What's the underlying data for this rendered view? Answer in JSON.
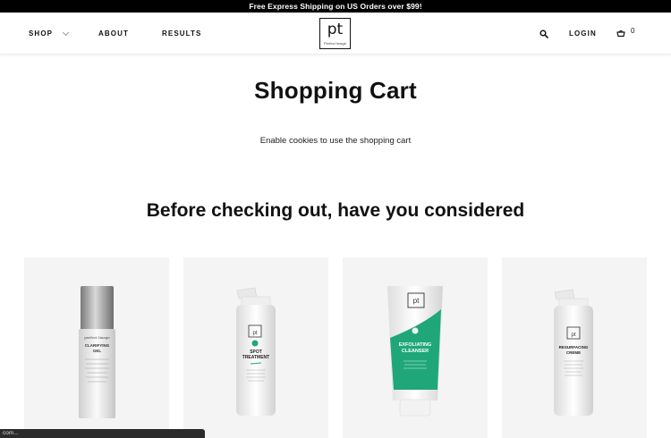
{
  "promo": {
    "text": "Free Express Shipping on US Orders over $99!"
  },
  "nav": {
    "shop": "SHOP",
    "about": "ABOUT",
    "results": "RESULTS",
    "login": "LOGIN",
    "cart_count": "0"
  },
  "logo": {
    "mark": "pt",
    "sub": "Perfect Image"
  },
  "main": {
    "title": "Shopping Cart",
    "cookie_message": "Enable cookies to use the shopping cart",
    "recommend_title": "Before checking out, have you considered"
  },
  "products": [
    {
      "brand": "perfect Image",
      "name_line1": "CLARIFYING",
      "name_line2": "GEL"
    },
    {
      "brand": "pt",
      "name_line1": "SPOT",
      "name_line2": "TREATMENT"
    },
    {
      "brand": "pt",
      "name_line1": "EXFOLIATING",
      "name_line2": "CLEANSER"
    },
    {
      "brand": "pt",
      "name_line1": "RESURFACING",
      "name_line2": "CREME"
    }
  ],
  "status_bar": {
    "text": "com..."
  },
  "colors": {
    "accent_green": "#1fa77a",
    "promo_bg": "#000000",
    "card_bg": "#f4f4f4"
  },
  "icons": [
    "chevron-down-icon",
    "search-icon",
    "cart-icon"
  ]
}
